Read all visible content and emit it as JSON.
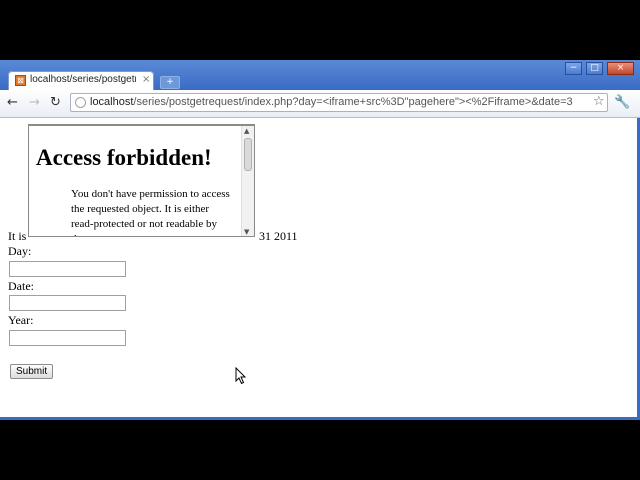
{
  "browser": {
    "tab": {
      "title": "localhost/series/postgetr...",
      "close": "×",
      "favicon_icon": "page-favicon"
    },
    "new_tab": "+",
    "window_controls": {
      "minimize": "−",
      "maximize": "□",
      "close": "×"
    },
    "nav": {
      "back": "←",
      "forward": "→",
      "reload": "↻"
    },
    "address": {
      "host": "localhost",
      "path": "/series/postgetrequest/index.php?day=<iframe+src%3D\"pagehere\"><%2Fiframe>&date=3"
    },
    "star": "☆",
    "wrench": "🔧"
  },
  "page": {
    "iframe": {
      "heading": "Access forbidden!",
      "message": "You don't have permission to access the requested object. It is either read-protected or not readable by the server."
    },
    "text_before": "It is",
    "text_after": "31 2011",
    "form": {
      "day_label": "Day:",
      "day_value": "",
      "date_label": "Date:",
      "date_value": "",
      "year_label": "Year:",
      "year_value": "",
      "submit_label": "Submit"
    }
  },
  "colors": {
    "chrome_blue": "#3a6cc4",
    "background": "#000000"
  }
}
